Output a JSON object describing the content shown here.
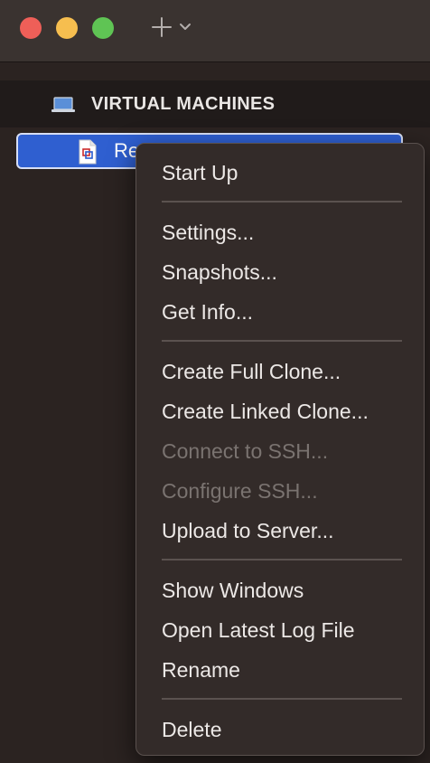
{
  "titlebar": {
    "add_icon": "plus-icon",
    "dropdown_icon": "chevron-down-icon"
  },
  "sidebar": {
    "section_title": "VIRTUAL MACHINES",
    "section_icon": "laptop-icon",
    "vm": {
      "name": "Re",
      "icon": "vm-document-icon"
    }
  },
  "context_menu": {
    "groups": [
      [
        {
          "label": "Start Up",
          "enabled": true
        }
      ],
      [
        {
          "label": "Settings...",
          "enabled": true
        },
        {
          "label": "Snapshots...",
          "enabled": true
        },
        {
          "label": "Get Info...",
          "enabled": true
        }
      ],
      [
        {
          "label": "Create Full Clone...",
          "enabled": true
        },
        {
          "label": "Create Linked Clone...",
          "enabled": true
        },
        {
          "label": "Connect to SSH...",
          "enabled": false
        },
        {
          "label": "Configure SSH...",
          "enabled": false
        },
        {
          "label": "Upload to Server...",
          "enabled": true
        }
      ],
      [
        {
          "label": "Show Windows",
          "enabled": true
        },
        {
          "label": "Open Latest Log File",
          "enabled": true
        },
        {
          "label": "Rename",
          "enabled": true
        }
      ],
      [
        {
          "label": "Delete",
          "enabled": true
        }
      ]
    ]
  },
  "colors": {
    "close": "#ee5f58",
    "minimize": "#f6be4f",
    "maximize": "#5fc454",
    "selection": "#2f5fd0"
  }
}
